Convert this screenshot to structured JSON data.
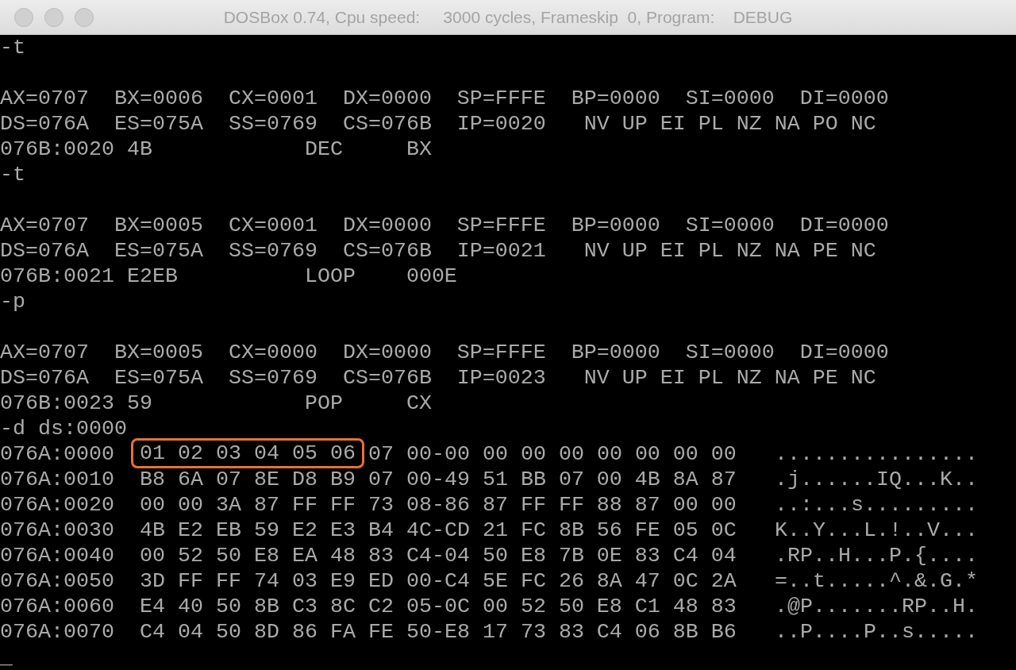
{
  "window": {
    "title": "DOSBox 0.74, Cpu speed:     3000 cycles, Frameskip  0, Program:    DEBUG"
  },
  "console": {
    "lines": [
      {
        "kind": "text",
        "text": "-t"
      },
      {
        "kind": "blank"
      },
      {
        "kind": "text",
        "text": "AX=0707  BX=0006  CX=0001  DX=0000  SP=FFFE  BP=0000  SI=0000  DI=0000"
      },
      {
        "kind": "text",
        "text": "DS=076A  ES=075A  SS=0769  CS=076B  IP=0020   NV UP EI PL NZ NA PO NC"
      },
      {
        "kind": "text",
        "text": "076B:0020 4B            DEC     BX"
      },
      {
        "kind": "text",
        "text": "-t"
      },
      {
        "kind": "blank"
      },
      {
        "kind": "text",
        "text": "AX=0707  BX=0005  CX=0001  DX=0000  SP=FFFE  BP=0000  SI=0000  DI=0000"
      },
      {
        "kind": "text",
        "text": "DS=076A  ES=075A  SS=0769  CS=076B  IP=0021   NV UP EI PL NZ NA PE NC"
      },
      {
        "kind": "text",
        "text": "076B:0021 E2EB          LOOP    000E"
      },
      {
        "kind": "text",
        "text": "-p"
      },
      {
        "kind": "blank"
      },
      {
        "kind": "text",
        "text": "AX=0707  BX=0005  CX=0000  DX=0000  SP=FFFE  BP=0000  SI=0000  DI=0000"
      },
      {
        "kind": "text",
        "text": "DS=076A  ES=075A  SS=0769  CS=076B  IP=0023   NV UP EI PL NZ NA PE NC"
      },
      {
        "kind": "text",
        "text": "076B:0023 59            POP     CX"
      },
      {
        "kind": "text",
        "text": "-d ds:0000"
      },
      {
        "kind": "dump",
        "address": "076A:0000",
        "highlighted_bytes": "01 02 03 04 05 06",
        "bytes": "07 00-00 00 00 00 00 00 00 00",
        "ascii": "................"
      },
      {
        "kind": "dump",
        "address": "076A:0010",
        "bytes": "B8 6A 07 8E D8 B9 07 00-49 51 BB 07 00 4B 8A 87",
        "ascii": ".j......IQ...K.."
      },
      {
        "kind": "dump",
        "address": "076A:0020",
        "bytes": "00 00 3A 87 FF FF 73 08-86 87 FF FF 88 87 00 00",
        "ascii": "..:...s........."
      },
      {
        "kind": "dump",
        "address": "076A:0030",
        "bytes": "4B E2 EB 59 E2 E3 B4 4C-CD 21 FC 8B 56 FE 05 0C",
        "ascii": "K..Y...L.!..V..."
      },
      {
        "kind": "dump",
        "address": "076A:0040",
        "bytes": "00 52 50 E8 EA 48 83 C4-04 50 E8 7B 0E 83 C4 04",
        "ascii": ".RP..H...P.{...."
      },
      {
        "kind": "dump",
        "address": "076A:0050",
        "bytes": "3D FF FF 74 03 E9 ED 00-C4 5E FC 26 8A 47 0C 2A",
        "ascii": "=..t.....^.&.G.*"
      },
      {
        "kind": "dump",
        "address": "076A:0060",
        "bytes": "E4 40 50 8B C3 8C C2 05-0C 00 52 50 E8 C1 48 83",
        "ascii": ".@P.......RP..H."
      },
      {
        "kind": "dump",
        "address": "076A:0070",
        "bytes": "C4 04 50 8D 86 FA FE 50-E8 17 73 83 C4 06 8B B6",
        "ascii": "..P....P..s....."
      },
      {
        "kind": "text",
        "text": "_"
      }
    ]
  }
}
